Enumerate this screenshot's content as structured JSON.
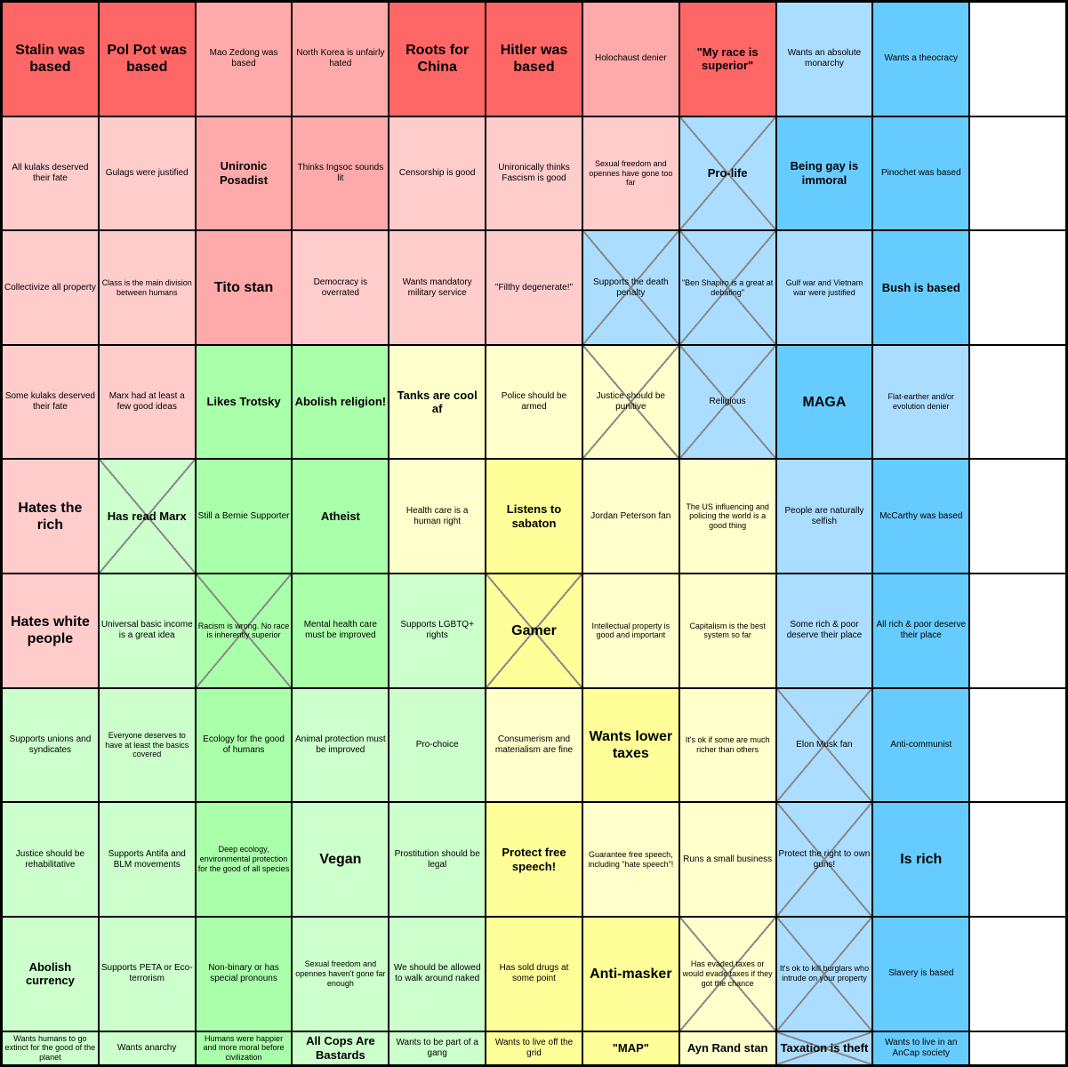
{
  "cells": [
    {
      "text": "Stalin was based",
      "color": "red",
      "size": "large-text",
      "crossed": false
    },
    {
      "text": "Pol Pot was based",
      "color": "red",
      "size": "large-text",
      "crossed": false
    },
    {
      "text": "Mao Zedong was based",
      "color": "pink",
      "size": "small-text",
      "crossed": false
    },
    {
      "text": "North Korea is unfairly hated",
      "color": "pink",
      "size": "small-text",
      "crossed": false
    },
    {
      "text": "Roots for China",
      "color": "red",
      "size": "large-text",
      "crossed": false
    },
    {
      "text": "Hitler was based",
      "color": "red",
      "size": "large-text",
      "crossed": false
    },
    {
      "text": "Holochaust denier",
      "color": "pink",
      "size": "small-text",
      "crossed": false
    },
    {
      "text": "\"My race is superior\"",
      "color": "red",
      "size": "medium-text",
      "crossed": false
    },
    {
      "text": "Wants an absolute monarchy",
      "color": "light-blue",
      "size": "small-text",
      "crossed": false
    },
    {
      "text": "Wants a theocracy",
      "color": "blue",
      "size": "small-text",
      "crossed": false
    },
    {
      "text": "",
      "color": "white-bg",
      "size": "small-text",
      "crossed": false
    },
    {
      "text": "All kulaks deserved their fate",
      "color": "light-pink",
      "size": "small-text",
      "crossed": false
    },
    {
      "text": "Gulags were justified",
      "color": "light-pink",
      "size": "small-text",
      "crossed": false
    },
    {
      "text": "Unironic Posadist",
      "color": "pink",
      "size": "medium-text",
      "crossed": false
    },
    {
      "text": "Thinks Ingsoc sounds lit",
      "color": "pink",
      "size": "small-text",
      "crossed": false
    },
    {
      "text": "Censorship is good",
      "color": "light-pink",
      "size": "small-text",
      "crossed": false
    },
    {
      "text": "Unironically thinks Fascism is good",
      "color": "light-pink",
      "size": "small-text",
      "crossed": false
    },
    {
      "text": "Sexual freedom and opennes have gone too far",
      "color": "light-pink",
      "size": "tiny-text",
      "crossed": false
    },
    {
      "text": "Pro-life",
      "color": "light-blue",
      "size": "medium-text",
      "crossed": true
    },
    {
      "text": "Being gay is immoral",
      "color": "blue",
      "size": "medium-text",
      "crossed": false
    },
    {
      "text": "Pinochet was based",
      "color": "blue",
      "size": "small-text",
      "crossed": false
    },
    {
      "text": "",
      "color": "white-bg",
      "size": "small-text",
      "crossed": false
    },
    {
      "text": "Collectivize all property",
      "color": "light-pink",
      "size": "small-text",
      "crossed": false
    },
    {
      "text": "Class is the main division between humans",
      "color": "light-pink",
      "size": "tiny-text",
      "crossed": false
    },
    {
      "text": "Tito stan",
      "color": "pink",
      "size": "large-text",
      "crossed": false
    },
    {
      "text": "Democracy is overrated",
      "color": "light-pink",
      "size": "small-text",
      "crossed": false
    },
    {
      "text": "Wants mandatory military service",
      "color": "light-pink",
      "size": "small-text",
      "crossed": false
    },
    {
      "text": "\"Filthy degenerate!\"",
      "color": "light-pink",
      "size": "small-text",
      "crossed": false
    },
    {
      "text": "Supports the death penalty",
      "color": "light-blue",
      "size": "small-text",
      "crossed": true
    },
    {
      "text": "\"Ben Shapiro is a great at debating\"",
      "color": "light-blue",
      "size": "tiny-text",
      "crossed": true
    },
    {
      "text": "Gulf war and Vietnam war were justified",
      "color": "light-blue",
      "size": "tiny-text",
      "crossed": false
    },
    {
      "text": "Bush is based",
      "color": "blue",
      "size": "medium-text",
      "crossed": false
    },
    {
      "text": "",
      "color": "white-bg",
      "size": "small-text",
      "crossed": false
    },
    {
      "text": "Some kulaks deserved their fate",
      "color": "light-pink",
      "size": "small-text",
      "crossed": false
    },
    {
      "text": "Marx had at least a few good ideas",
      "color": "light-pink",
      "size": "small-text",
      "crossed": false
    },
    {
      "text": "Likes Trotsky",
      "color": "green",
      "size": "medium-text",
      "crossed": false
    },
    {
      "text": "Abolish religion!",
      "color": "green",
      "size": "medium-text",
      "crossed": false
    },
    {
      "text": "Tanks are cool af",
      "color": "light-yellow",
      "size": "medium-text",
      "crossed": false
    },
    {
      "text": "Police should be armed",
      "color": "light-yellow",
      "size": "small-text",
      "crossed": false
    },
    {
      "text": "Justice should be punitive",
      "color": "light-yellow",
      "size": "small-text",
      "crossed": true
    },
    {
      "text": "Religious",
      "color": "light-blue",
      "size": "small-text",
      "crossed": true
    },
    {
      "text": "MAGA",
      "color": "blue",
      "size": "large-text",
      "crossed": false
    },
    {
      "text": "Flat-earther and/or evolution denier",
      "color": "light-blue",
      "size": "tiny-text",
      "crossed": false
    },
    {
      "text": "",
      "color": "white-bg",
      "size": "small-text",
      "crossed": false
    },
    {
      "text": "Hates the rich",
      "color": "light-pink",
      "size": "large-text",
      "crossed": false
    },
    {
      "text": "Has read Marx",
      "color": "light-green",
      "size": "medium-text",
      "crossed": true
    },
    {
      "text": "Still a Bernie Supporter",
      "color": "green",
      "size": "small-text",
      "crossed": false
    },
    {
      "text": "Atheist",
      "color": "green",
      "size": "medium-text",
      "crossed": false
    },
    {
      "text": "Health care is a human right",
      "color": "light-yellow",
      "size": "small-text",
      "crossed": false
    },
    {
      "text": "Listens to sabaton",
      "color": "yellow",
      "size": "medium-text",
      "crossed": false
    },
    {
      "text": "Jordan Peterson fan",
      "color": "light-yellow",
      "size": "small-text",
      "crossed": false
    },
    {
      "text": "The US influencing and policing the world is a good thing",
      "color": "light-yellow",
      "size": "tiny-text",
      "crossed": false
    },
    {
      "text": "People are naturally selfish",
      "color": "light-blue",
      "size": "small-text",
      "crossed": false
    },
    {
      "text": "McCarthy was based",
      "color": "blue",
      "size": "small-text",
      "crossed": false
    },
    {
      "text": "",
      "color": "white-bg",
      "size": "small-text",
      "crossed": false
    },
    {
      "text": "Hates white people",
      "color": "light-pink",
      "size": "large-text",
      "crossed": false
    },
    {
      "text": "Universal basic income is a great idea",
      "color": "light-green",
      "size": "small-text",
      "crossed": false
    },
    {
      "text": "Racism is wrong. No race is inherently superior",
      "color": "green",
      "size": "tiny-text",
      "crossed": true
    },
    {
      "text": "Mental health care must be improved",
      "color": "green",
      "size": "small-text",
      "crossed": false
    },
    {
      "text": "Supports LGBTQ+ rights",
      "color": "light-green",
      "size": "small-text",
      "crossed": false
    },
    {
      "text": "Gamer",
      "color": "yellow",
      "size": "large-text",
      "crossed": true
    },
    {
      "text": "Intellectual property is good and important",
      "color": "light-yellow",
      "size": "tiny-text",
      "crossed": false
    },
    {
      "text": "Capitalism is the best system so far",
      "color": "light-yellow",
      "size": "tiny-text",
      "crossed": false
    },
    {
      "text": "Some rich & poor deserve their place",
      "color": "light-blue",
      "size": "small-text",
      "crossed": false
    },
    {
      "text": "All rich & poor deserve their place",
      "color": "blue",
      "size": "small-text",
      "crossed": false
    },
    {
      "text": "",
      "color": "white-bg",
      "size": "small-text",
      "crossed": false
    },
    {
      "text": "Supports unions and syndicates",
      "color": "light-green",
      "size": "small-text",
      "crossed": false
    },
    {
      "text": "Everyone deserves to have at least the basics covered",
      "color": "light-green",
      "size": "tiny-text",
      "crossed": false
    },
    {
      "text": "Ecology for the good of humans",
      "color": "green",
      "size": "small-text",
      "crossed": false
    },
    {
      "text": "Animal protection must be improved",
      "color": "light-green",
      "size": "small-text",
      "crossed": false
    },
    {
      "text": "Pro-choice",
      "color": "light-green",
      "size": "small-text",
      "crossed": false
    },
    {
      "text": "Consumerism and materialism are fine",
      "color": "light-yellow",
      "size": "small-text",
      "crossed": false
    },
    {
      "text": "Wants lower taxes",
      "color": "yellow",
      "size": "large-text",
      "crossed": false
    },
    {
      "text": "It's ok if some are much richer than others",
      "color": "light-yellow",
      "size": "tiny-text",
      "crossed": false
    },
    {
      "text": "Elon Musk fan",
      "color": "light-blue",
      "size": "small-text",
      "crossed": true
    },
    {
      "text": "Anti-communist",
      "color": "blue",
      "size": "small-text",
      "crossed": false
    },
    {
      "text": "",
      "color": "white-bg",
      "size": "small-text",
      "crossed": false
    },
    {
      "text": "Justice should be rehabilitative",
      "color": "light-green",
      "size": "small-text",
      "crossed": false
    },
    {
      "text": "Supports Antifa and BLM movements",
      "color": "light-green",
      "size": "small-text",
      "crossed": false
    },
    {
      "text": "Deep ecology, environmental protection for the good of all species",
      "color": "green",
      "size": "tiny-text",
      "crossed": false
    },
    {
      "text": "Vegan",
      "color": "light-green",
      "size": "large-text",
      "crossed": false
    },
    {
      "text": "Prostitution should be legal",
      "color": "light-green",
      "size": "small-text",
      "crossed": false
    },
    {
      "text": "Protect free speech!",
      "color": "yellow",
      "size": "medium-text",
      "crossed": false
    },
    {
      "text": "Guarantee free speech, including \"hate speech\"!",
      "color": "light-yellow",
      "size": "tiny-text",
      "crossed": false
    },
    {
      "text": "Runs a small business",
      "color": "light-yellow",
      "size": "small-text",
      "crossed": false
    },
    {
      "text": "Protect the right to own guns!",
      "color": "light-blue",
      "size": "small-text",
      "crossed": true
    },
    {
      "text": "Is rich",
      "color": "blue",
      "size": "large-text",
      "crossed": false
    },
    {
      "text": "",
      "color": "white-bg",
      "size": "small-text",
      "crossed": false
    },
    {
      "text": "Abolish currency",
      "color": "light-green",
      "size": "medium-text",
      "crossed": false
    },
    {
      "text": "Supports PETA or Eco-terrorism",
      "color": "light-green",
      "size": "small-text",
      "crossed": false
    },
    {
      "text": "Non-binary or has special pronouns",
      "color": "green",
      "size": "small-text",
      "crossed": false
    },
    {
      "text": "Sexual freedom and opennes haven't gone far enough",
      "color": "light-green",
      "size": "tiny-text",
      "crossed": false
    },
    {
      "text": "We should be allowed to walk around naked",
      "color": "light-green",
      "size": "small-text",
      "crossed": false
    },
    {
      "text": "Has sold drugs at some point",
      "color": "yellow",
      "size": "small-text",
      "crossed": false
    },
    {
      "text": "Anti-masker",
      "color": "yellow",
      "size": "large-text",
      "crossed": false
    },
    {
      "text": "Has evaded taxes or would evade taxes if they got the chance",
      "color": "light-yellow",
      "size": "tiny-text",
      "crossed": true
    },
    {
      "text": "It's ok to kill burglars who intrude on your property",
      "color": "light-blue",
      "size": "tiny-text",
      "crossed": true
    },
    {
      "text": "Slavery is based",
      "color": "blue",
      "size": "small-text",
      "crossed": false
    },
    {
      "text": "",
      "color": "white-bg",
      "size": "small-text",
      "crossed": false
    },
    {
      "text": "Wants humans to go extinct for the good of the planet",
      "color": "light-green",
      "size": "tiny-text",
      "crossed": false
    },
    {
      "text": "Wants anarchy",
      "color": "light-green",
      "size": "small-text",
      "crossed": false
    },
    {
      "text": "Humans were happier and more moral before civilization",
      "color": "green",
      "size": "tiny-text",
      "crossed": false
    },
    {
      "text": "All Cops Are Bastards",
      "color": "light-green",
      "size": "medium-text",
      "crossed": false
    },
    {
      "text": "Wants to be part of a gang",
      "color": "light-green",
      "size": "small-text",
      "crossed": false
    },
    {
      "text": "Wants to live off the grid",
      "color": "yellow",
      "size": "small-text",
      "crossed": false
    },
    {
      "text": "\"MAP\"",
      "color": "yellow",
      "size": "medium-text",
      "crossed": false
    },
    {
      "text": "Ayn Rand stan",
      "color": "light-yellow",
      "size": "medium-text",
      "crossed": false
    },
    {
      "text": "Taxation is theft",
      "color": "light-blue",
      "size": "medium-text",
      "crossed": true
    },
    {
      "text": "Wants to live in an AnCap society",
      "color": "blue",
      "size": "small-text",
      "crossed": false
    },
    {
      "text": "",
      "color": "white-bg",
      "size": "small-text",
      "crossed": false
    }
  ]
}
